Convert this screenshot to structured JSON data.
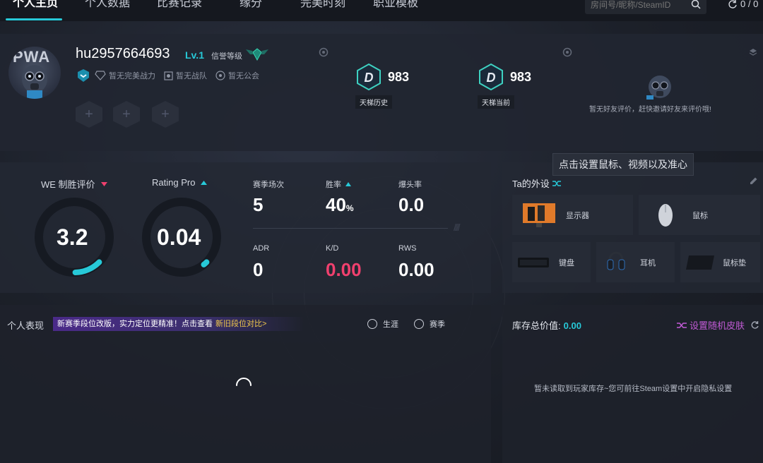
{
  "nav": {
    "tabs": [
      {
        "label": "个人主页",
        "active": true
      },
      {
        "label": "个人数据",
        "active": false
      },
      {
        "label": "比赛记录",
        "active": false
      },
      {
        "label": "缘分",
        "active": false
      },
      {
        "label": "完美时刻",
        "active": false
      },
      {
        "label": "职业模板",
        "active": false
      }
    ],
    "search_placeholder": "房间号/昵称/SteamID",
    "counter": "0 / 0"
  },
  "profile": {
    "avatar_text": "PWA",
    "username": "hu2957664693",
    "level": "Lv.1",
    "credit_label": "信誉等级",
    "badges": [
      "暂无完美战力",
      "暂无战队",
      "暂无公会"
    ],
    "ladder": [
      {
        "score": "983",
        "label": "天梯历史"
      },
      {
        "score": "983",
        "label": "天梯当前"
      }
    ],
    "friend_eval": "暂无好友评价，赶快邀请好友来评价哦!"
  },
  "stats": {
    "we": {
      "label": "WE 制胜评价",
      "value": "3.2",
      "fraction": 0.16
    },
    "rating": {
      "label": "Rating Pro",
      "value": "0.04",
      "fraction": 0.02
    },
    "grid": [
      {
        "label": "赛季场次",
        "value": "5"
      },
      {
        "label": "胜率",
        "value": "40",
        "unit": "%"
      },
      {
        "label": "爆头率",
        "value": "0.0"
      },
      {
        "label": "ADR",
        "value": "0"
      },
      {
        "label": "K/D",
        "value": "0.00"
      },
      {
        "label": "RWS",
        "value": "0.00"
      }
    ]
  },
  "gear": {
    "title": "Ta的外设",
    "tooltip": "点击设置鼠标、视频以及准心",
    "items": [
      "显示器",
      "鼠标",
      "键盘",
      "耳机",
      "鼠标垫"
    ]
  },
  "performance": {
    "title": "个人表现",
    "notice": "新赛季段位改版，实力定位更精准！点击查看",
    "notice_link": "新旧段位对比>",
    "radio": [
      "生涯",
      "赛季"
    ]
  },
  "inventory": {
    "label": "库存总价值:",
    "value": "0.00",
    "skin_button": "设置随机皮肤",
    "empty_text": "暂未读取到玩家库存~您可前往Steam设置中开启隐私设置"
  },
  "colors": {
    "accent": "#27c9d8",
    "pink": "#f0406e",
    "purple": "#c25bd6",
    "gold": "#f2c94c"
  }
}
